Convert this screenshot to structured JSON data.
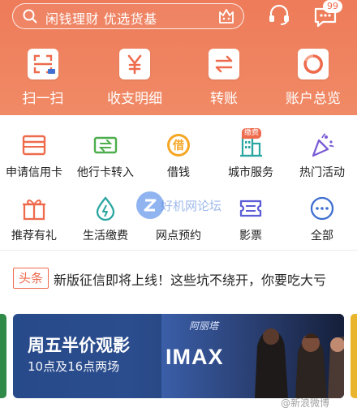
{
  "search": {
    "placeholder": "闲钱理财 优选货基"
  },
  "header": {
    "message_badge": "99"
  },
  "quick_actions": [
    {
      "label": "扫一扫",
      "icon": "scan-icon"
    },
    {
      "label": "收支明细",
      "icon": "yen-icon"
    },
    {
      "label": "转账",
      "icon": "transfer-icon"
    },
    {
      "label": "账户总览",
      "icon": "account-overview-icon"
    }
  ],
  "services_row1": [
    {
      "label": "申请信用卡",
      "icon": "credit-card-icon"
    },
    {
      "label": "他行卡转入",
      "icon": "card-transfer-in-icon"
    },
    {
      "label": "借钱",
      "icon": "borrow-icon",
      "glyph": "借"
    },
    {
      "label": "城市服务",
      "icon": "city-building-icon",
      "tag": "缴费"
    },
    {
      "label": "热门活动",
      "icon": "party-popper-icon"
    }
  ],
  "services_row2": [
    {
      "label": "推荐有礼",
      "icon": "gift-icon"
    },
    {
      "label": "生活缴费",
      "icon": "water-drop-icon"
    },
    {
      "label": "网点预约",
      "icon": "branch-booking-icon"
    },
    {
      "label": "影票",
      "icon": "movie-ticket-icon"
    },
    {
      "label": "全部",
      "icon": "more-icon"
    }
  ],
  "watermark": {
    "text": "好机网论坛"
  },
  "news": {
    "tag": "头条",
    "text": "新版征信即将上线！这些坑不绕开，你要吃大亏"
  },
  "banner": {
    "title": "周五半价观影",
    "subtitle": "10点及16点两场",
    "imax": "IMAX",
    "movie_title": "阿丽塔"
  },
  "footer_watermark": "@新浪微博",
  "colors": {
    "accent": "#ee6b4d",
    "hero": "#f08a66",
    "banner": "#274a8a"
  }
}
